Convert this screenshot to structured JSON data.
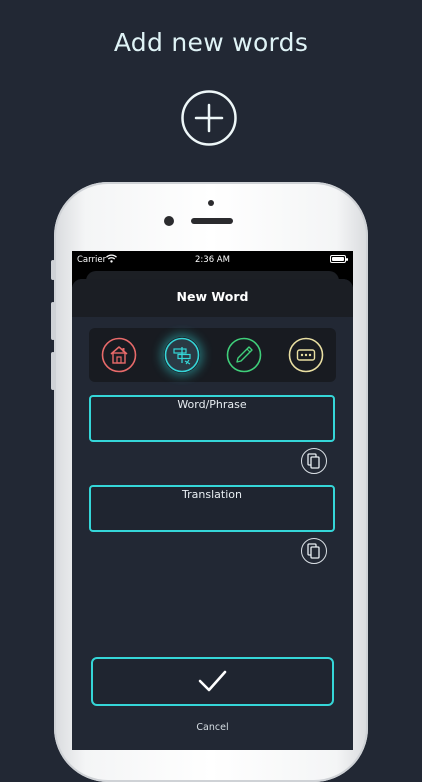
{
  "headline": "Add new words",
  "status_bar": {
    "carrier": "Carrier",
    "time": "2:36 AM"
  },
  "nav": {
    "title": "New Word"
  },
  "categories": [
    {
      "icon": "house-icon",
      "color": "#e86a6a"
    },
    {
      "icon": "road-sign-icon",
      "color": "#35d6d8",
      "selected": true
    },
    {
      "icon": "pencil-icon",
      "color": "#3fcf7a"
    },
    {
      "icon": "ellipsis-icon",
      "color": "#e9dfa2"
    }
  ],
  "fields": {
    "word_label": "Word/Phrase",
    "translation_label": "Translation"
  },
  "actions": {
    "cancel_label": "Cancel"
  },
  "colors": {
    "background": "#222834",
    "accent": "#35d6d8"
  }
}
